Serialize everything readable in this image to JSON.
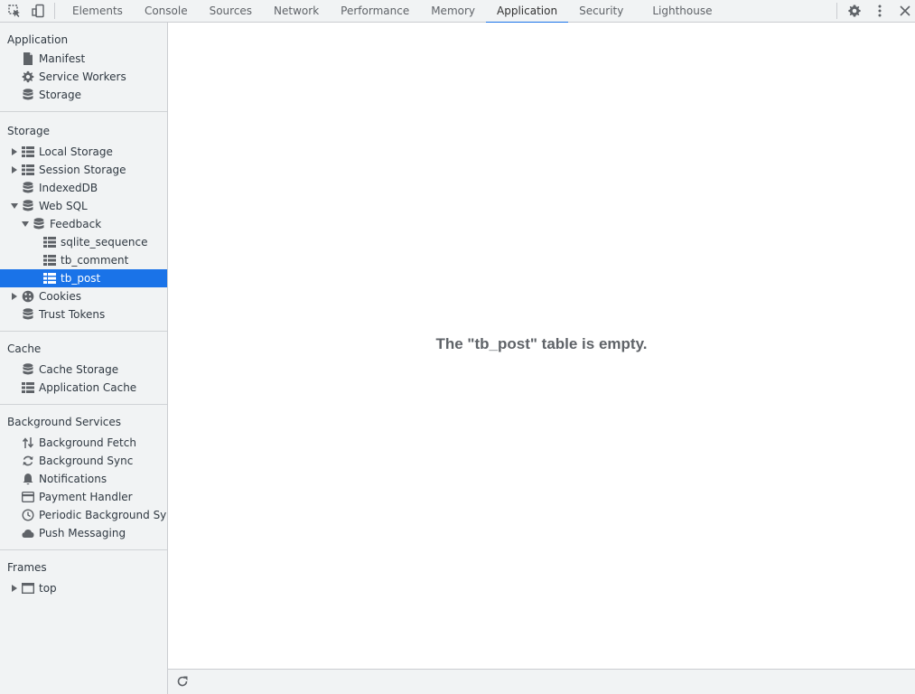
{
  "toolbar": {
    "tabs": [
      {
        "label": "Elements"
      },
      {
        "label": "Console"
      },
      {
        "label": "Sources"
      },
      {
        "label": "Network"
      },
      {
        "label": "Performance"
      },
      {
        "label": "Memory"
      },
      {
        "label": "Application",
        "selected": true
      },
      {
        "label": "Security"
      },
      {
        "label": "Lighthouse"
      }
    ],
    "accent_color": "#1a73e8"
  },
  "sidebar": {
    "application": {
      "title": "Application",
      "items": [
        {
          "label": "Manifest",
          "icon": "document-icon"
        },
        {
          "label": "Service Workers",
          "icon": "gear-icon"
        },
        {
          "label": "Storage",
          "icon": "database-icon"
        }
      ]
    },
    "storage": {
      "title": "Storage",
      "items": [
        {
          "label": "Local Storage",
          "icon": "table-icon"
        },
        {
          "label": "Session Storage",
          "icon": "table-icon"
        },
        {
          "label": "IndexedDB",
          "icon": "database-icon"
        },
        {
          "label": "Web SQL",
          "icon": "database-icon"
        },
        {
          "label": "Feedback",
          "icon": "database-icon"
        },
        {
          "label": "sqlite_sequence",
          "icon": "table-icon"
        },
        {
          "label": "tb_comment",
          "icon": "table-icon"
        },
        {
          "label": "tb_post",
          "icon": "table-icon",
          "selected": true
        },
        {
          "label": "Cookies",
          "icon": "cookie-icon"
        },
        {
          "label": "Trust Tokens",
          "icon": "database-icon"
        }
      ]
    },
    "cache": {
      "title": "Cache",
      "items": [
        {
          "label": "Cache Storage",
          "icon": "database-icon"
        },
        {
          "label": "Application Cache",
          "icon": "table-icon"
        }
      ]
    },
    "background": {
      "title": "Background Services",
      "items": [
        {
          "label": "Background Fetch",
          "icon": "up-down-arrows-icon"
        },
        {
          "label": "Background Sync",
          "icon": "sync-icon"
        },
        {
          "label": "Notifications",
          "icon": "bell-icon"
        },
        {
          "label": "Payment Handler",
          "icon": "card-icon"
        },
        {
          "label": "Periodic Background Sync",
          "icon": "clock-icon"
        },
        {
          "label": "Push Messaging",
          "icon": "cloud-icon"
        }
      ]
    },
    "frames": {
      "title": "Frames",
      "items": [
        {
          "label": "top",
          "icon": "frame-icon"
        }
      ]
    }
  },
  "main": {
    "empty_message": "The \"tb_post\" table is empty."
  }
}
